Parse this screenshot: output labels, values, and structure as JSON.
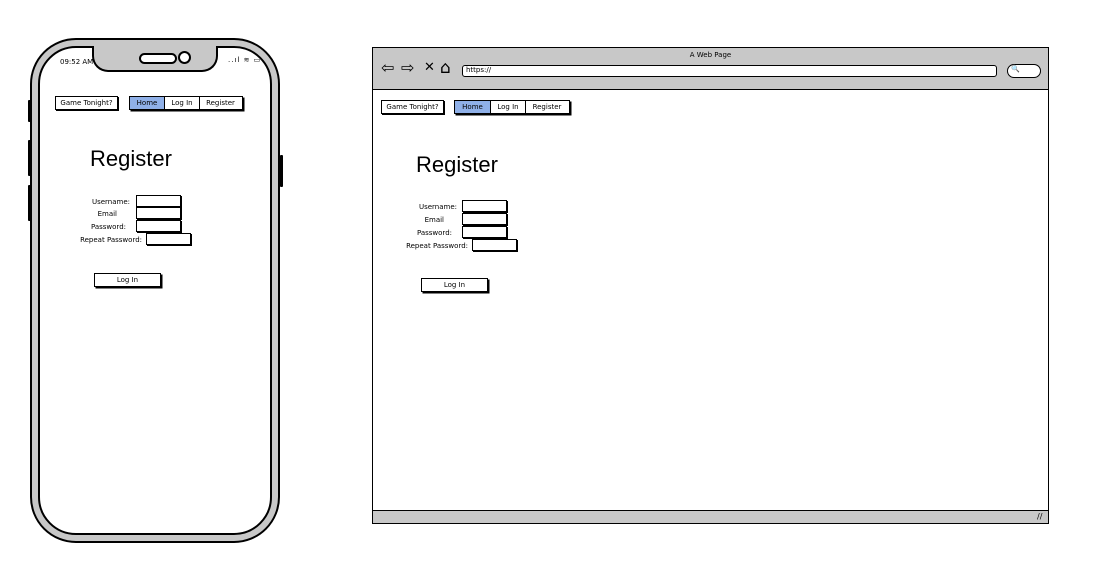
{
  "phone": {
    "status_time": "09:52 AM",
    "status_icons": "..ıl ≋ ▭"
  },
  "browser": {
    "window_title": "A Web Page",
    "url": "https://",
    "back_icon": "⇦",
    "forward_icon": "⇨",
    "close_icon": "✕",
    "home_icon": "⌂",
    "search_icon": "🔍"
  },
  "app": {
    "brand_button": "Game Tonight?",
    "tabs": [
      "Home",
      "Log In",
      "Register"
    ],
    "active_tab": "Home",
    "heading": "Register",
    "fields": {
      "username": "Username:",
      "email": "Email",
      "password": "Password:",
      "repeat_password": "Repeat Password:"
    },
    "submit_button": "Log In"
  },
  "colors": {
    "active_tab": "#8fb0e8",
    "frame_gray": "#c8c8c8"
  }
}
